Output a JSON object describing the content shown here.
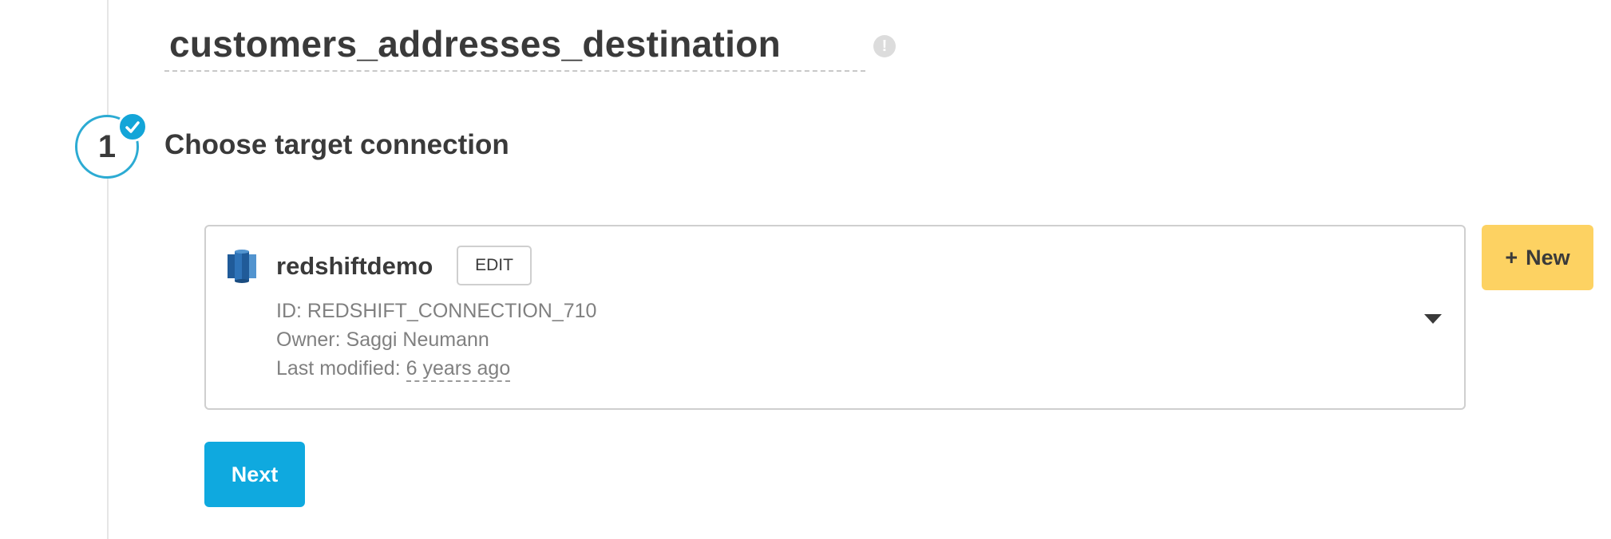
{
  "destination": {
    "name": "customers_addresses_destination"
  },
  "icons": {
    "warning": "exclamation-circle-icon",
    "step_check": "check-icon",
    "database": "redshift-database-icon",
    "dropdown": "caret-down-icon",
    "plus": "plus-icon"
  },
  "step": {
    "number": "1",
    "title": "Choose target connection",
    "completed": true
  },
  "connection": {
    "name": "redshiftdemo",
    "edit_label": "EDIT",
    "id_line": "ID: REDSHIFT_CONNECTION_710",
    "owner_line": "Owner: Saggi Neumann",
    "modified_label": "Last modified:",
    "modified_value": "6 years ago"
  },
  "actions": {
    "new_plus": "+",
    "new_label": "New",
    "next_label": "Next"
  },
  "colors": {
    "accent_blue": "#0fa9df",
    "step_ring": "#2cabd3",
    "new_button": "#fdd262",
    "redshift_blue": "#205b99"
  }
}
